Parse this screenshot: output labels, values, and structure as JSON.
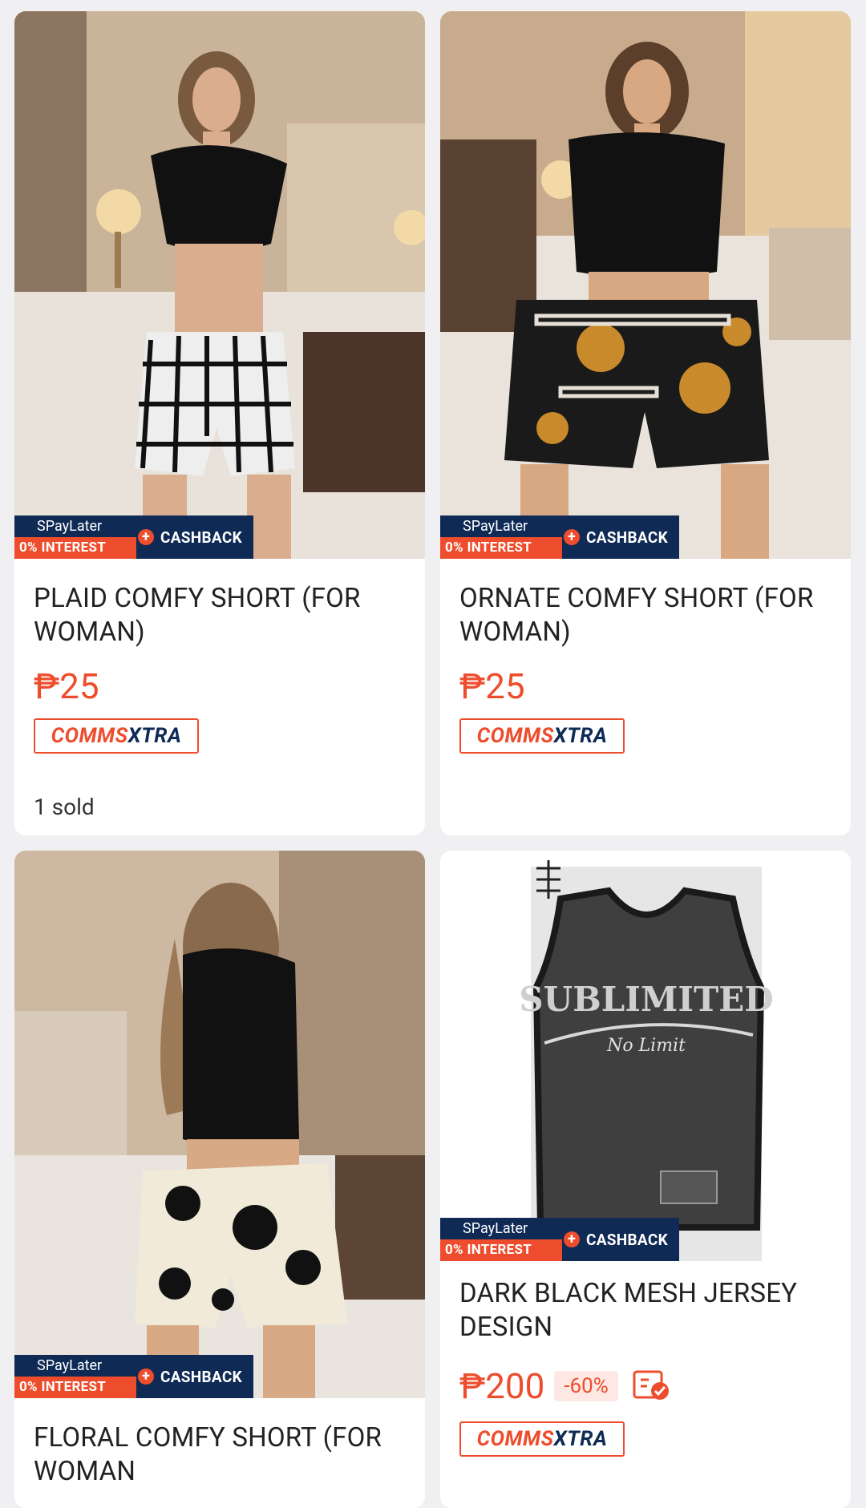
{
  "products": [
    {
      "title": "PLAID COMFY SHORT (FOR WOMAN)",
      "price": "₱25",
      "badge_top": "SPayLater",
      "badge_bottom": "0% INTEREST",
      "cashback": "CASHBACK",
      "comms_a": "COMMS",
      "comms_b": "XTRA",
      "sold": "1 sold"
    },
    {
      "title": "ORNATE COMFY SHORT (FOR WOMAN)",
      "price": "₱25",
      "badge_top": "SPayLater",
      "badge_bottom": "0% INTEREST",
      "cashback": "CASHBACK",
      "comms_a": "COMMS",
      "comms_b": "XTRA"
    },
    {
      "title": "FLORAL COMFY SHORT (FOR WOMAN",
      "badge_top": "SPayLater",
      "badge_bottom": "0% INTEREST",
      "cashback": "CASHBACK"
    },
    {
      "title": "DARK BLACK MESH JERSEY DESIGN",
      "price": "₱200",
      "discount": "-60%",
      "badge_top": "SPayLater",
      "badge_bottom": "0% INTEREST",
      "cashback": "CASHBACK",
      "comms_a": "COMMS",
      "comms_b": "XTRA",
      "jersey_text": "SUBLIMITED",
      "jersey_subtext": "No Limit"
    }
  ],
  "colors": {
    "accent": "#ee4d2d",
    "navy": "#0e2a55"
  }
}
